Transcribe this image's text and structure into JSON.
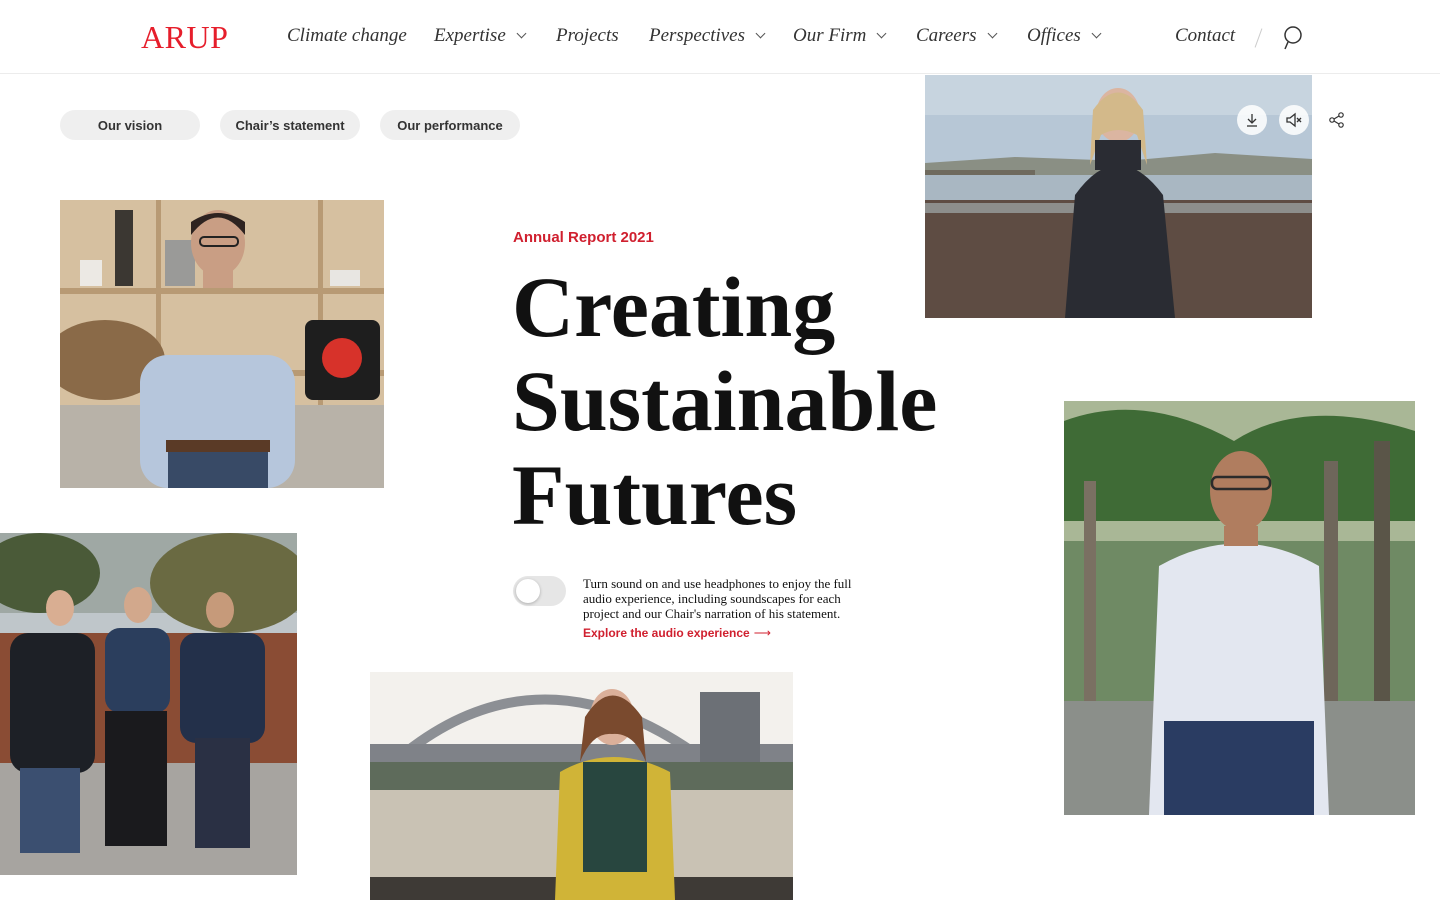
{
  "brand": {
    "logo": "ARUP",
    "accent_color": "#e61e2b"
  },
  "nav": {
    "items": [
      {
        "label": "Climate change",
        "dropdown": false
      },
      {
        "label": "Expertise",
        "dropdown": true
      },
      {
        "label": "Projects",
        "dropdown": false
      },
      {
        "label": "Perspectives",
        "dropdown": true
      },
      {
        "label": "Our Firm",
        "dropdown": true
      },
      {
        "label": "Careers",
        "dropdown": true
      },
      {
        "label": "Offices",
        "dropdown": true
      }
    ],
    "contact": "Contact",
    "search_icon": "search-icon"
  },
  "sections": {
    "pills": [
      "Our vision",
      "Chair’s statement",
      "Our performance"
    ]
  },
  "hero": {
    "eyebrow": "Annual Report 2021",
    "title_lines": [
      "Creating",
      "Sustainable",
      "Futures"
    ]
  },
  "audio": {
    "toggle_on": false,
    "description": "Turn sound on and use headphones to enjoy the full audio experience, including soundscapes for each project and our Chair's narration of his statement.",
    "link": "Explore the audio experience"
  },
  "tools": {
    "download_icon": "download-icon",
    "mute_icon": "speaker-muted-icon",
    "share_icon": "share-icon"
  },
  "photos": [
    {
      "name": "photo-man-in-studio"
    },
    {
      "name": "photo-woman-on-beach"
    },
    {
      "name": "photo-three-men-garden"
    },
    {
      "name": "photo-woman-by-bridge"
    },
    {
      "name": "photo-man-palms"
    }
  ]
}
